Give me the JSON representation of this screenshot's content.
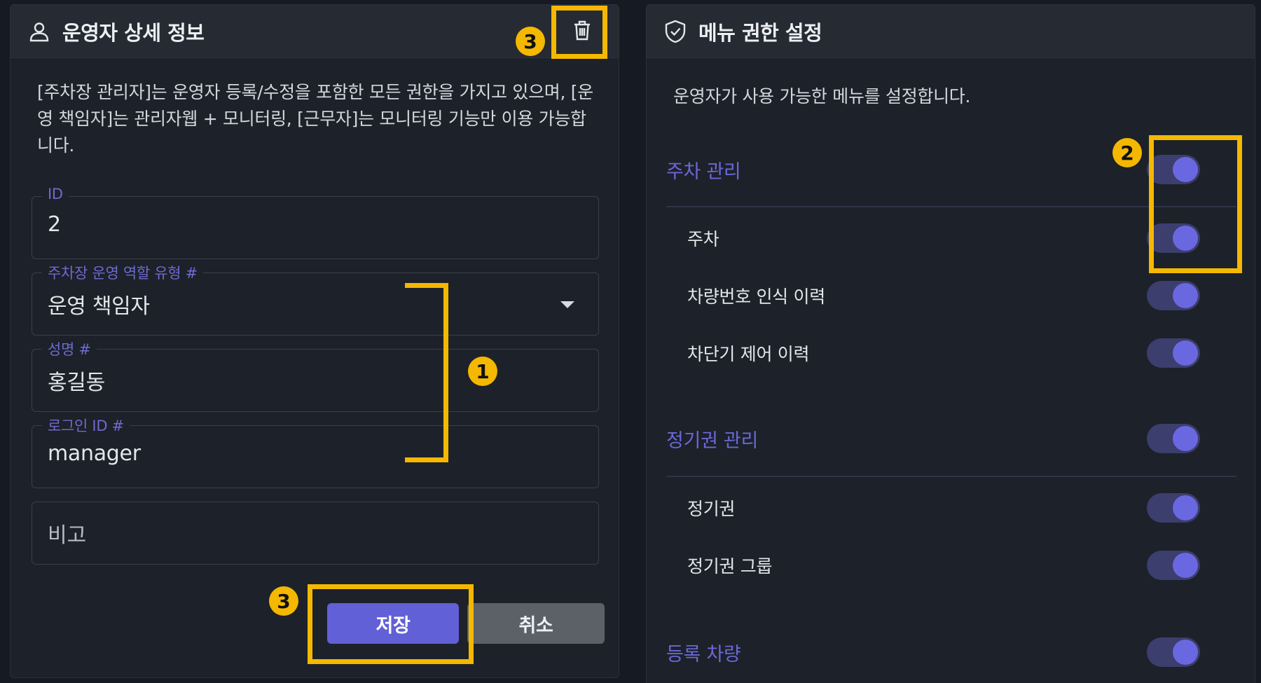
{
  "left_panel": {
    "title": "운영자 상세 정보",
    "description": "[주차장 관리자]는 운영자 등록/수정을 포함한 모든 권한을 가지고 있으며, [운영 책임자]는 관리자웹 + 모니터링, [근무자]는 모니터링 기능만 이용 가능합니다.",
    "fields": {
      "id": {
        "label": "ID",
        "value": "2"
      },
      "role": {
        "label": "주차장 운영 역할 유형 #",
        "value": "운영 책임자"
      },
      "name": {
        "label": "성명 #",
        "value": "홍길동"
      },
      "login_id": {
        "label": "로그인 ID #",
        "value": "manager"
      },
      "note": {
        "placeholder": "비고"
      }
    },
    "buttons": {
      "save": "저장",
      "cancel": "취소"
    },
    "icons": {
      "header": "user-icon",
      "delete": "trash-icon"
    }
  },
  "right_panel": {
    "title": "메뉴 권한 설정",
    "description": "운영자가 사용 가능한 메뉴를 설정합니다.",
    "icon": "shield-check-icon",
    "menus": {
      "parking_mgmt": {
        "label": "주차 관리",
        "enabled": true
      },
      "parking": {
        "label": "주차",
        "enabled": true
      },
      "plate_history": {
        "label": "차량번호 인식 이력",
        "enabled": true
      },
      "barrier_history": {
        "label": "차단기 제어 이력",
        "enabled": true
      },
      "pass_mgmt": {
        "label": "정기권 관리",
        "enabled": true
      },
      "pass": {
        "label": "정기권",
        "enabled": true
      },
      "pass_group": {
        "label": "정기권 그룹",
        "enabled": true
      },
      "registered_vehicle": {
        "label": "등록 차량",
        "enabled": true
      }
    }
  },
  "annotations": {
    "badge_1": "1",
    "badge_2": "2",
    "badge_3_top": "3",
    "badge_3_bottom": "3",
    "color": "#f5b800"
  },
  "colors": {
    "accent": "#6260d6",
    "background": "#161a22",
    "panel": "#1d2129",
    "toggle_track": "#3c3e6e",
    "toggle_knob": "#6a68e0"
  }
}
